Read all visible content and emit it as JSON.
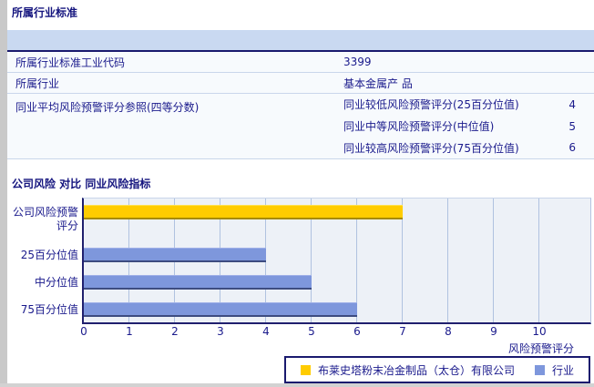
{
  "section1": {
    "title": "所属行业标准"
  },
  "section2": {
    "title": "公司风险 对比 同业风险指标"
  },
  "table": {
    "rows": [
      {
        "label": "所属行业标准工业代码",
        "value": "3399"
      },
      {
        "label": "所属行业",
        "value": "基本金属产 品"
      },
      {
        "label": "同业平均风险预警评分参照(四等分数)"
      }
    ],
    "subrows": [
      {
        "label": "同业较低风险预警评分(25百分位值)",
        "value": "4"
      },
      {
        "label": "同业中等风险预警评分(中位值)",
        "value": "5"
      },
      {
        "label": "同业较高风险预警评分(75百分位值)",
        "value": "6"
      }
    ]
  },
  "chart_data": {
    "type": "bar",
    "orientation": "horizontal",
    "categories": [
      "公司风险预警评分",
      "25百分位值",
      "中分位值",
      "75百分位值"
    ],
    "series": [
      {
        "name": "布莱史塔粉末冶金制品（太仓）有限公司",
        "color": "#FFCC00",
        "values": [
          7,
          null,
          null,
          null
        ]
      },
      {
        "name": "行业",
        "color": "#7E97DC",
        "values": [
          null,
          4,
          5,
          6
        ]
      }
    ],
    "xlabel": "风险预警评分",
    "xlim": [
      0,
      10
    ],
    "xticks": [
      0,
      1,
      2,
      3,
      4,
      5,
      6,
      7,
      8,
      9,
      10
    ],
    "grid": true,
    "legend_position": "bottom"
  },
  "colors": {
    "accent_text": "#1A1A8C",
    "header_band": "#C9D9F1",
    "dark_border": "#1A1A6E",
    "plot_bg": "#EDF1F7",
    "gridline": "#B0C2E0",
    "bar_company": "#FFCC00",
    "bar_industry": "#7E97DC"
  }
}
